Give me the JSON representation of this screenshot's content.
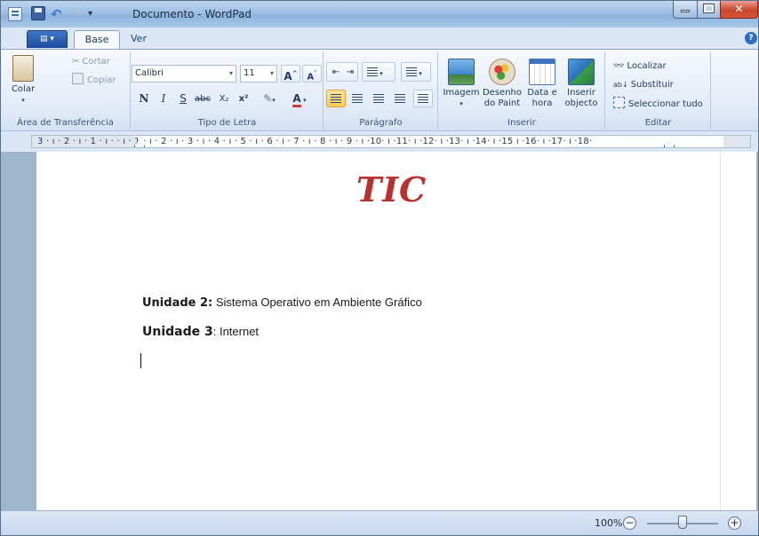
{
  "window": {
    "title": "Documento - WordPad",
    "quick_access_more": "▾"
  },
  "tabs": [
    {
      "label": "Base",
      "active": true
    },
    {
      "label": "Ver",
      "active": false
    }
  ],
  "ribbon": {
    "clipboard": {
      "paste_label": "Colar",
      "cut_label": "Cortar",
      "copy_label": "Copiar",
      "group_label": "Área de Transferência"
    },
    "font": {
      "family": "Calibri",
      "size": "11",
      "grow_label": "A",
      "shrink_label": "A",
      "bold_label": "N",
      "italic_label": "I",
      "underline_label": "S",
      "strike_label": "abc",
      "subscript_label": "X₂",
      "superscript_label": "x²",
      "color_label": "A",
      "group_label": "Tipo de Letra"
    },
    "paragraph": {
      "group_label": "Parágrafo"
    },
    "insert": {
      "image_label": "Imagem",
      "paint_label_1": "Desenho",
      "paint_label_2": "do Paint",
      "datetime_label_1": "Data e",
      "datetime_label_2": "hora",
      "object_label_1": "Inserir",
      "object_label_2": "objecto",
      "group_label": "Inserir"
    },
    "edit": {
      "find_label": "Localizar",
      "replace_label": "Substituir",
      "select_all_label": "Seleccionar tudo",
      "group_label": "Editar"
    }
  },
  "ruler": {
    "text": "3 · ı · 2 · ı · 1 · ı ·   · ı · 1 · ı · 2 · ı · 3 · ı · 4 · ı · 5 · ı · 6 · ı · 7 · ı · 8 · ı · 9 · ı ·10· ı ·11· ı ·12· ı ·13· ı ·14· ı ·15 ı ·16· ı ·17· ı ·18·"
  },
  "document": {
    "heading": "TIC",
    "line1_label": "Unidade 2:",
    "line1_text": " Sistema Operativo em Ambiente Gráfico",
    "line2_label": "Unidade  3",
    "line2_text": ": Internet"
  },
  "status": {
    "zoom": "100%",
    "zoom_level_fraction": 0.5
  },
  "colors": {
    "heading": "#b8312f",
    "ribbon": "#dfe9f6",
    "workspace": "#9fb5cc"
  }
}
